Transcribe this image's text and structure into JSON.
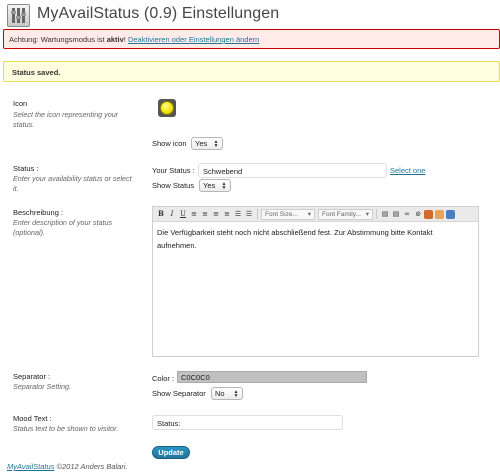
{
  "header": {
    "title": "MyAvailStatus (0.9) Einstellungen",
    "icon": "settings-tools-icon"
  },
  "maintenance_notice": {
    "prefix": "Achtung: Wartungsmodus ist ",
    "status": "aktiv",
    "suffix": "! ",
    "link": "Deaktivieren oder Einstellungen ändern"
  },
  "status_notice": {
    "text": "Status saved."
  },
  "icon_section": {
    "label": "Icon",
    "description": "Select the icon representing your status.",
    "show_icon_label": "Show icon",
    "show_icon_value": "Yes",
    "icon": "yellow-status-light-icon"
  },
  "status_section": {
    "label": "Status :",
    "description": "Enter your availability status or select it.",
    "your_status_label": "Your Status :",
    "your_status_value": "Schwebend",
    "select_one_link": "Select one",
    "show_status_label": "Show Status",
    "show_status_value": "Yes"
  },
  "description_section": {
    "label": "Beschreibung :",
    "description": "Enter description of your status (optional).",
    "editor_text": "Die Verfügbarkeit steht noch nicht abschließend fest. Zur Abstimmung bitte Kontakt aufnehmen.",
    "toolbar": {
      "bold": "B",
      "italic": "I",
      "underline": "U",
      "font_size": "Font Size...",
      "font_family": "Font Family..."
    }
  },
  "separator_section": {
    "label": "Separator :",
    "description": "Separator Setting.",
    "color_label": "Color :",
    "color_value": "C0C0C0",
    "show_separator_label": "Show Separator",
    "show_separator_value": "No"
  },
  "mood_section": {
    "label": "Mood Text :",
    "description": "Status text to be shown to visitor.",
    "value": "Status:"
  },
  "actions": {
    "update_label": "Update"
  },
  "footer": {
    "link": "MyAvailStatus",
    "text": " ©2012 Anders Balari."
  },
  "colors": {
    "link": "#21759b",
    "error_border": "#cc0000",
    "error_bg": "#ffebe8",
    "success_bg": "#ffffe0",
    "success_border": "#e6db55",
    "separator_color": "#c0c0c0",
    "button": "#21759b"
  }
}
